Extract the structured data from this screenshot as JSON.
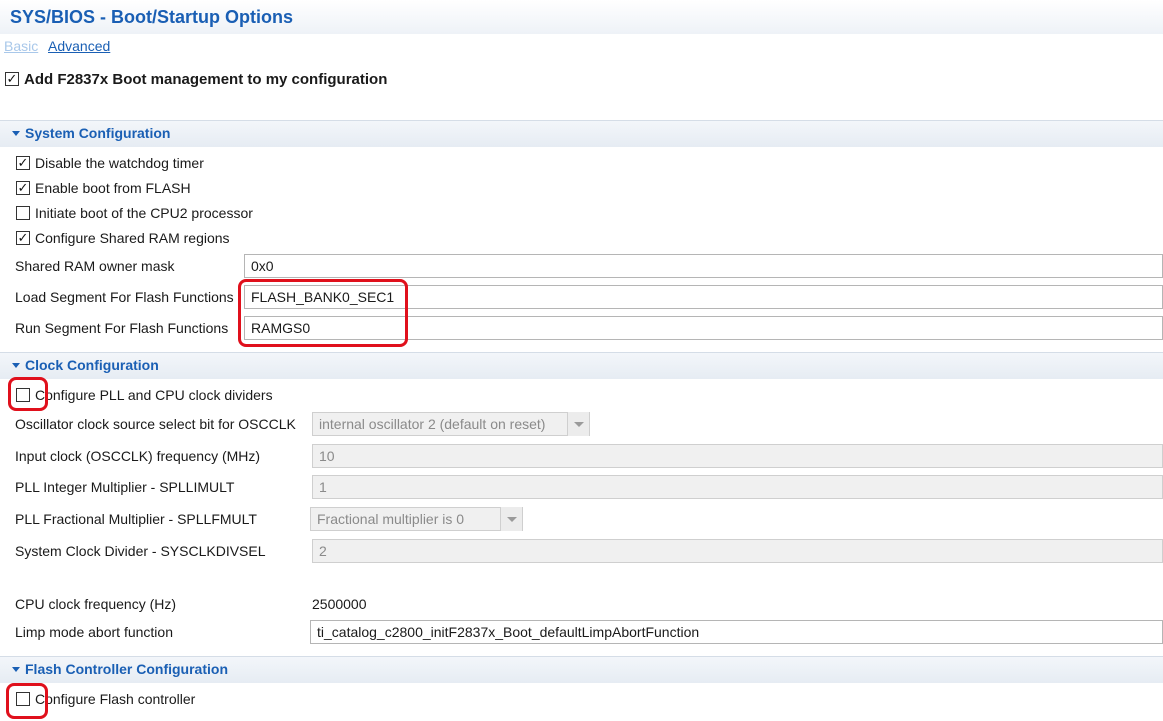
{
  "header": {
    "title": "SYS/BIOS - Boot/Startup Options"
  },
  "tabs": {
    "basic": "Basic",
    "advanced": "Advanced"
  },
  "main_toggle": {
    "label": "Add F2837x Boot management to my configuration",
    "checked": true
  },
  "system": {
    "title": "System Configuration",
    "watchdog": {
      "label": "Disable the watchdog timer",
      "checked": true
    },
    "boot_flash": {
      "label": "Enable boot from FLASH",
      "checked": true
    },
    "cpu2": {
      "label": "Initiate boot of the CPU2 processor",
      "checked": false
    },
    "shared_ram": {
      "label": "Configure Shared RAM regions",
      "checked": true
    },
    "owner_mask": {
      "label": "Shared RAM owner mask",
      "value": "0x0"
    },
    "load_segment": {
      "label": "Load Segment For Flash Functions",
      "value": "FLASH_BANK0_SEC1"
    },
    "run_segment": {
      "label": "Run Segment For Flash Functions",
      "value": "RAMGS0"
    }
  },
  "clock": {
    "title": "Clock Configuration",
    "pll": {
      "label": "Configure PLL and CPU clock dividers",
      "checked": false
    },
    "osc_source": {
      "label": "Oscillator clock source select bit for OSCCLK",
      "value": "internal oscillator 2 (default on reset)"
    },
    "input_clock": {
      "label": "Input clock (OSCCLK) frequency (MHz)",
      "value": "10"
    },
    "pll_int": {
      "label": "PLL Integer Multiplier - SPLLIMULT",
      "value": "1"
    },
    "pll_frac": {
      "label": "PLL Fractional Multiplier - SPLLFMULT",
      "value": "Fractional multiplier is 0"
    },
    "sysclk_div": {
      "label": "System Clock Divider - SYSCLKDIVSEL",
      "value": "2"
    },
    "cpu_freq": {
      "label": "CPU clock frequency (Hz)",
      "value": "2500000"
    },
    "limp": {
      "label": "Limp mode abort function",
      "value": "ti_catalog_c2800_initF2837x_Boot_defaultLimpAbortFunction"
    }
  },
  "flash": {
    "title": "Flash Controller Configuration",
    "configure": {
      "label": "Configure Flash controller",
      "checked": false
    }
  },
  "icons": {
    "check": "✓",
    "collapse": "triangle-down-icon",
    "dropdown": "chevron-down-icon"
  },
  "colors": {
    "accent": "#1a5fb4",
    "highlight": "#e0101c"
  }
}
